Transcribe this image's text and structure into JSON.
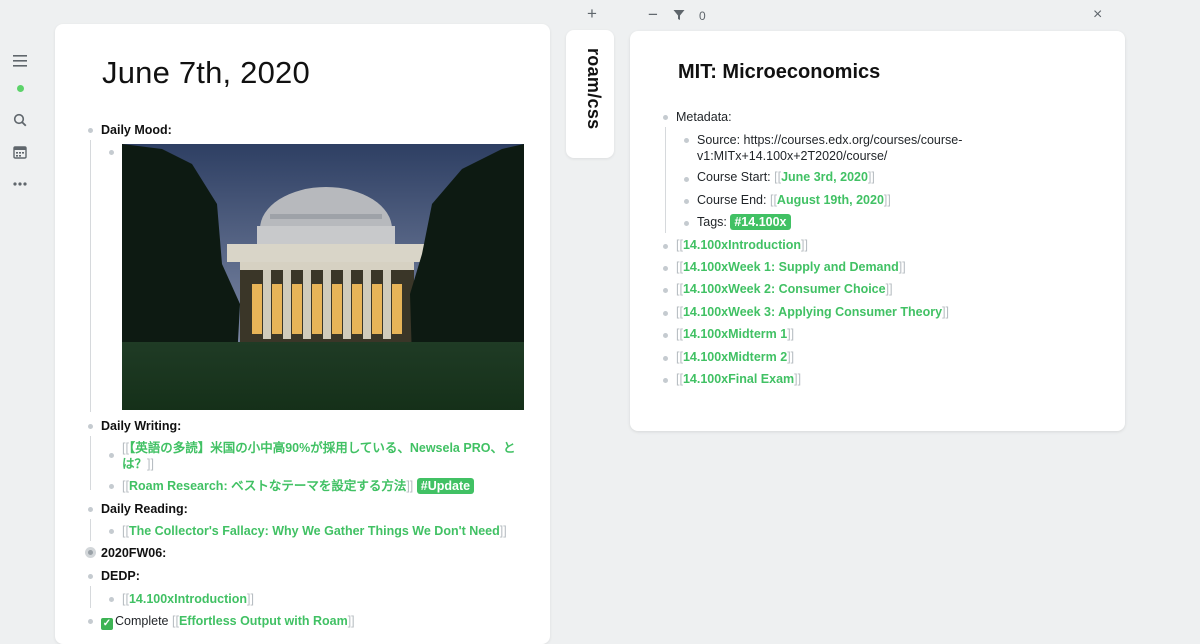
{
  "rail": {
    "icons": [
      "menu-icon",
      "status-dot-icon",
      "search-icon",
      "calendar-icon",
      "more-icon"
    ]
  },
  "main": {
    "title": "June 7th, 2020",
    "daily_mood": "Daily Mood:",
    "daily_writing": "Daily Writing:",
    "writing_items": [
      {
        "line1": "【英語の多読】米国の小中高90%が採用している、Newsela PRO、と",
        "line2": "は？"
      },
      {
        "text": "Roam Research: ベストなテーマを設定する方法",
        "tag": "#Update"
      }
    ],
    "daily_reading": "Daily Reading:",
    "reading_items": [
      "The Collector's Fallacy: Why We Gather Things We Don't Need"
    ],
    "fw": "2020FW06:",
    "dedp": "DEDP:",
    "dedp_items": [
      "14.100xIntroduction"
    ],
    "complete_label": "Complete",
    "complete_link": "Effortless Output with Roam"
  },
  "middle": {
    "plus": "+",
    "tab_label": "roam/css"
  },
  "sidebar": {
    "minus": "−",
    "filter_count": "0",
    "close": "×",
    "title": "MIT: Microeconomics",
    "metadata_label": "Metadata:",
    "source_line1": "Source: https://courses.edx.org/courses/course-",
    "source_line2": "v1:MITx+14.100x+2T2020/course/",
    "course_start_label": "Course Start: ",
    "course_start": "June 3rd, 2020",
    "course_end_label": "Course End: ",
    "course_end": "August 19th, 2020",
    "tags_label": "Tags: ",
    "tag": "#14.100x",
    "links": [
      "14.100xIntroduction",
      "14.100xWeek 1: Supply and Demand",
      "14.100xWeek 2: Consumer Choice",
      "14.100xWeek 3: Applying Consumer Theory",
      "14.100xMidterm 1",
      "14.100xMidterm 2",
      "14.100xFinal Exam"
    ]
  },
  "colors": {
    "link_green": "#41c164",
    "background": "#eef0f1",
    "bracket_gray": "#b7bdc2"
  }
}
